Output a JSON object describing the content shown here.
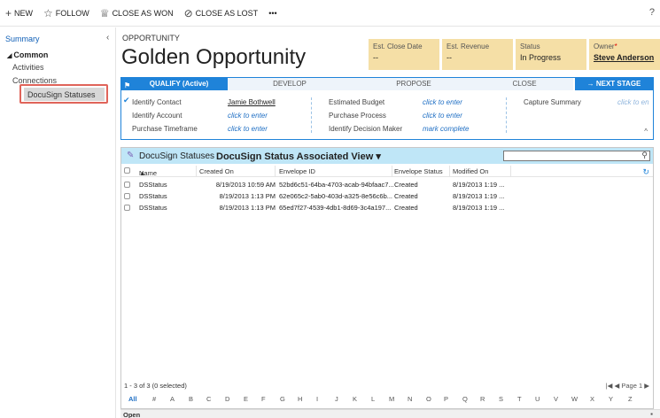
{
  "commands": {
    "new": "NEW",
    "follow": "FOLLOW",
    "close_won": "CLOSE AS WON",
    "close_lost": "CLOSE AS LOST",
    "more": "•••",
    "help": "?"
  },
  "nav": {
    "summary": "Summary",
    "group": "Common",
    "activities": "Activities",
    "connections": "Connections",
    "docusign": "DocuSign Statuses"
  },
  "header": {
    "entity": "OPPORTUNITY",
    "title": "Golden Opportunity",
    "fields": [
      {
        "label": "Est. Close Date",
        "value": "--"
      },
      {
        "label": "Est. Revenue",
        "value": "--"
      },
      {
        "label": "Status",
        "value": "In Progress"
      },
      {
        "label": "Owner",
        "value": "Steve Anderson",
        "required": "*"
      }
    ]
  },
  "process": {
    "stages": [
      "QUALIFY (Active)",
      "DEVELOP",
      "PROPOSE",
      "CLOSE"
    ],
    "next": "→ NEXT STAGE",
    "steps": [
      {
        "label": "Identify Contact",
        "value": "Jamie Bothwell"
      },
      {
        "label": "Identify Account",
        "value": "click to enter"
      },
      {
        "label": "Purchase Timeframe",
        "value": "click to enter"
      },
      {
        "label": "Estimated Budget",
        "value": "click to enter"
      },
      {
        "label": "Purchase Process",
        "value": "click to enter"
      },
      {
        "label": "Identify Decision Maker",
        "value": "mark complete"
      },
      {
        "label": "Capture Summary",
        "value": "click to en"
      }
    ]
  },
  "grid": {
    "title": "DocuSign Statuses",
    "view": "DocuSign Status Associated View",
    "view_caret": "▾",
    "columns": [
      "Name",
      "Created On",
      "Envelope ID",
      "Envelope Status",
      "Modified On"
    ],
    "sort_indicator": "▲",
    "rows": [
      {
        "name": "DSStatus",
        "created": "8/19/2013 10:59 AM",
        "envelope": "52bd6c51-64ba-4703-acab-94bfaac7...",
        "status": "Created",
        "modified": "8/19/2013 1:19 ..."
      },
      {
        "name": "DSStatus",
        "created": "8/19/2013 1:13 PM",
        "envelope": "62e065c2-5ab0-403d-a325-8e56c6b...",
        "status": "Created",
        "modified": "8/19/2013 1:19 ..."
      },
      {
        "name": "DSStatus",
        "created": "8/19/2013 1:13 PM",
        "envelope": "65ed7f27-4539-4db1-8d69-3c4a197...",
        "status": "Created",
        "modified": "8/19/2013 1:19 ..."
      }
    ],
    "count": "1 - 3 of 3 (0 selected)",
    "paging": "|◀  ◀  Page 1  ▶",
    "alphabet": [
      "All",
      "#",
      "A",
      "B",
      "C",
      "D",
      "E",
      "F",
      "G",
      "H",
      "I",
      "J",
      "K",
      "L",
      "M",
      "N",
      "O",
      "P",
      "Q",
      "R",
      "S",
      "T",
      "U",
      "V",
      "W",
      "X",
      "Y",
      "Z"
    ]
  },
  "footer": {
    "status": "Open"
  },
  "icons": {
    "new": "plus-icon",
    "follow": "star-icon",
    "close_won": "trophy-icon",
    "close_lost": "cancel-circle-icon",
    "grid": "docusign-icon",
    "search": "search-icon",
    "refresh": "refresh-icon",
    "save": "save-icon"
  },
  "colors": {
    "accent": "#1f83d9",
    "header_field_bg": "#f5dfa6",
    "grid_header_bg": "#bfe6f7",
    "highlight_border": "#e0645a"
  }
}
